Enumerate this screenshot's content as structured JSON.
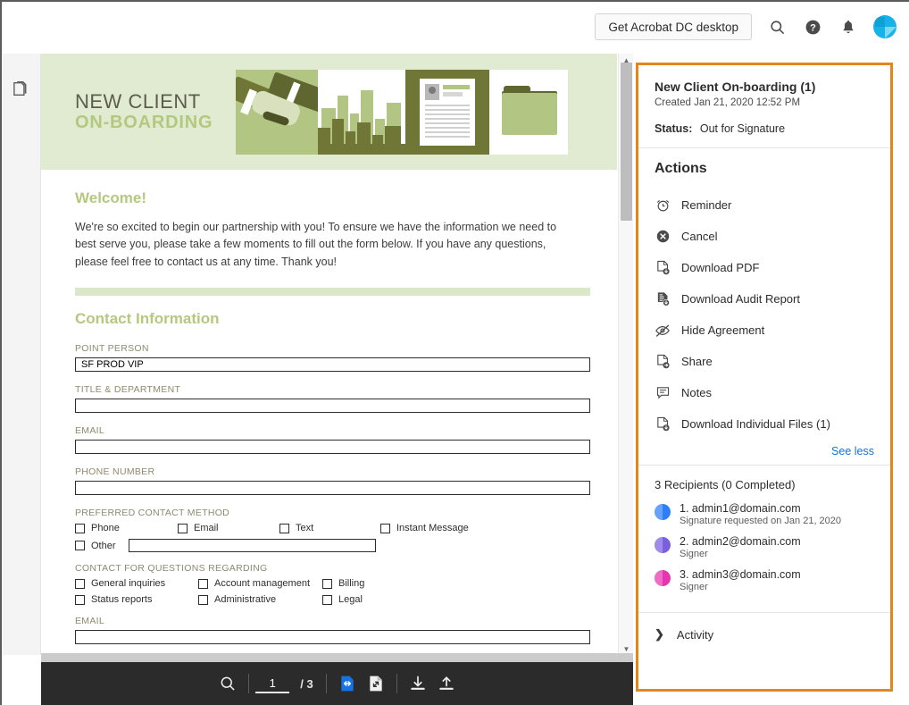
{
  "header": {
    "acrobat_button": "Get Acrobat DC desktop",
    "search_icon": "search-icon",
    "help_icon": "help-icon",
    "bell_icon": "notifications-icon",
    "avatar_icon": "user-avatar"
  },
  "left_rail": {
    "pages_icon": "page-thumbnails-icon"
  },
  "document": {
    "hero": {
      "line1": "NEW CLIENT",
      "line2": "ON-BOARDING"
    },
    "welcome_heading": "Welcome!",
    "welcome_text": "We're so excited to begin our partnership with you! To ensure we have the information we need to best serve you, please take a few moments to fill out the form below. If you have any questions, please feel free to contact us at any time. Thank you!",
    "section_heading": "Contact Information",
    "fields": [
      {
        "label": "POINT PERSON",
        "value": "SF PROD VIP"
      },
      {
        "label": "TITLE & DEPARTMENT",
        "value": ""
      },
      {
        "label": "EMAIL",
        "value": ""
      },
      {
        "label": "PHONE NUMBER",
        "value": ""
      }
    ],
    "preferred_label": "PREFERRED CONTACT METHOD",
    "preferred_options": [
      "Phone",
      "Email",
      "Text",
      "Instant Message"
    ],
    "other_label": "Other",
    "other_value": "",
    "questions_label": "CONTACT FOR QUESTIONS REGARDING",
    "questions_options": [
      "General inquiries",
      "Account management",
      "Billing",
      "Status reports",
      "Administrative",
      "Legal"
    ],
    "final_email_label": "EMAIL",
    "final_email_value": ""
  },
  "toolbar": {
    "search_icon": "search-icon",
    "page_current": "1",
    "page_total": "/ 3",
    "fit_width_icon": "fit-width-icon",
    "fit_page_icon": "fit-page-icon",
    "download_icon": "download-icon",
    "upload_icon": "upload-icon"
  },
  "panel": {
    "agreement_title": "New Client On-boarding (1)",
    "created": "Created Jan 21, 2020 12:52 PM",
    "status_label": "Status:",
    "status_value": "Out for Signature",
    "actions_heading": "Actions",
    "actions": [
      {
        "label": "Reminder",
        "icon": "reminder-clock-icon"
      },
      {
        "label": "Cancel",
        "icon": "cancel-x-icon"
      },
      {
        "label": "Download PDF",
        "icon": "download-pdf-icon"
      },
      {
        "label": "Download Audit Report",
        "icon": "download-audit-report-icon"
      },
      {
        "label": "Hide Agreement",
        "icon": "hide-eye-icon"
      },
      {
        "label": "Share",
        "icon": "share-icon"
      },
      {
        "label": "Notes",
        "icon": "notes-icon"
      },
      {
        "label": "Download Individual Files (1)",
        "icon": "download-files-icon"
      }
    ],
    "see_less": "See less",
    "recipients_heading": "3 Recipients (0 Completed)",
    "recipients": [
      {
        "name": "1. admin1@domain.com",
        "sub": "Signature requested on Jan 21, 2020",
        "color": "#2d7ff9"
      },
      {
        "name": "2. admin2@domain.com",
        "sub": "Signer",
        "color": "#7b5fe0"
      },
      {
        "name": "3. admin3@domain.com",
        "sub": "Signer",
        "color": "#e734b0"
      }
    ],
    "activity_label": "Activity",
    "activity_icon": "chevron-right-icon",
    "border_color": "#e5861d"
  }
}
